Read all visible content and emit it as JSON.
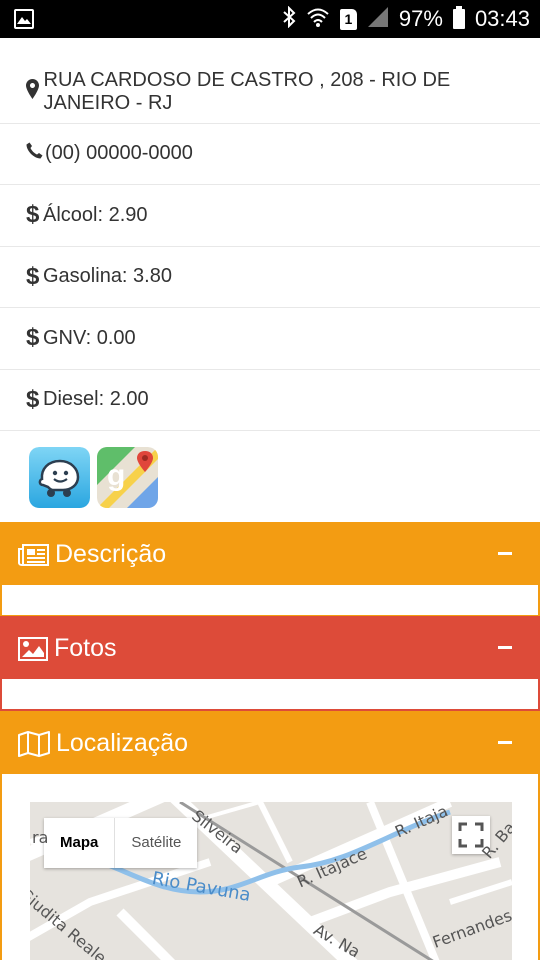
{
  "status_bar": {
    "battery": "97%",
    "time": "03:43",
    "sim": "1"
  },
  "info": {
    "address": "RUA CARDOSO DE CASTRO , 208 - RIO DE JANEIRO - RJ",
    "phone": "(00) 00000-0000",
    "prices": [
      {
        "label": "Álcool: 2.90"
      },
      {
        "label": "Gasolina: 3.80"
      },
      {
        "label": "GNV: 0.00"
      },
      {
        "label": "Diesel: 2.00"
      }
    ]
  },
  "apps": [
    {
      "icon": "waze-icon"
    },
    {
      "icon": "google-maps-icon"
    }
  ],
  "panels": {
    "descricao": {
      "title": "Descrição",
      "color": "#f39c12"
    },
    "fotos": {
      "title": "Fotos",
      "color": "#dd4b39"
    },
    "localizacao": {
      "title": "Localização",
      "color": "#f39c12"
    }
  },
  "map": {
    "map_label": "Mapa",
    "satellite_label": "Satélite",
    "streets": [
      "Silveira",
      "R. Itajace",
      "R. Itaja",
      "Rio Pavuna",
      "Giudita Reale",
      "Av. Na",
      "Fernandes",
      "R. Ba",
      "ra"
    ]
  }
}
